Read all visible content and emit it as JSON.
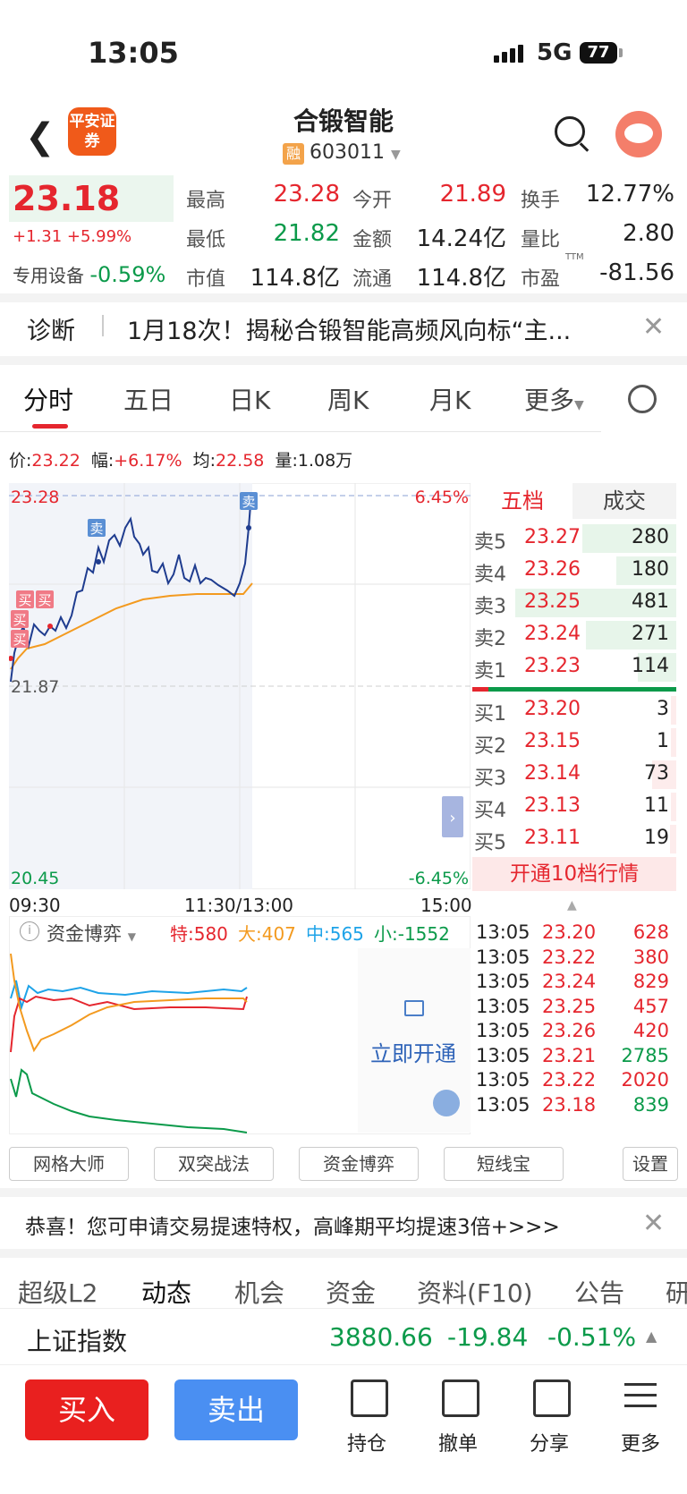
{
  "status": {
    "time": "13:05",
    "network": "5G",
    "battery": "77"
  },
  "header": {
    "broker_logo": "平安证券",
    "stock_name": "合锻智能",
    "rong": "融",
    "code": "603011"
  },
  "quote": {
    "price": "23.18",
    "change": "+1.31 +5.99%",
    "sector_label": "专用设备",
    "sector_change": "-0.59%",
    "high_label": "最高",
    "high": "23.28",
    "open_label": "今开",
    "open": "21.89",
    "turnover_label": "换手",
    "turnover": "12.77%",
    "low_label": "最低",
    "low": "21.82",
    "amount_label": "金额",
    "amount": "14.24亿",
    "ratio_label": "量比",
    "ratio": "2.80",
    "mktcap_label": "市值",
    "mktcap": "114.8亿",
    "float_label": "流通",
    "float": "114.8亿",
    "pe_label": "市盈",
    "pe_sup": "TTM",
    "pe": "-81.56"
  },
  "diagnosis": {
    "label": "诊断",
    "text": "1月18次！揭秘合锻智能高频风向标“主..."
  },
  "tabs": [
    "分时",
    "五日",
    "日K",
    "周K",
    "月K",
    "更多"
  ],
  "info_bar": {
    "price_label": "价:",
    "price": "23.22",
    "amp_label": "幅:",
    "amp": "+6.17%",
    "avg_label": "均:",
    "avg": "22.58",
    "vol_label": "量:",
    "vol": "1.08万"
  },
  "chart": {
    "y_top": "23.28",
    "y_mid": "21.87",
    "y_bottom": "20.45",
    "pct_top": "6.45%",
    "pct_bottom": "-6.45%",
    "x_start": "09:30",
    "x_mid": "11:30/13:00",
    "x_end": "15:00",
    "sell_tag": "卖",
    "buy_tag": "买"
  },
  "orderbook": {
    "tab_five": "五档",
    "tab_trades": "成交",
    "asks": [
      {
        "label": "卖5",
        "price": "23.27",
        "vol": "280"
      },
      {
        "label": "卖4",
        "price": "23.26",
        "vol": "180"
      },
      {
        "label": "卖3",
        "price": "23.25",
        "vol": "481"
      },
      {
        "label": "卖2",
        "price": "23.24",
        "vol": "271"
      },
      {
        "label": "卖1",
        "price": "23.23",
        "vol": "114"
      }
    ],
    "bids": [
      {
        "label": "买1",
        "price": "23.20",
        "vol": "3"
      },
      {
        "label": "买2",
        "price": "23.15",
        "vol": "1"
      },
      {
        "label": "买3",
        "price": "23.14",
        "vol": "73"
      },
      {
        "label": "买4",
        "price": "23.13",
        "vol": "11"
      },
      {
        "label": "买5",
        "price": "23.11",
        "vol": "19"
      }
    ],
    "open10": "开通10档行情"
  },
  "trades": [
    {
      "time": "13:05",
      "price": "23.20",
      "vol": "628",
      "color": "red"
    },
    {
      "time": "13:05",
      "price": "23.22",
      "vol": "380",
      "color": "red"
    },
    {
      "time": "13:05",
      "price": "23.24",
      "vol": "829",
      "color": "red"
    },
    {
      "time": "13:05",
      "price": "23.25",
      "vol": "457",
      "color": "red"
    },
    {
      "time": "13:05",
      "price": "23.26",
      "vol": "420",
      "color": "red"
    },
    {
      "time": "13:05",
      "price": "23.21",
      "vol": "2785",
      "color": "green"
    },
    {
      "time": "13:05",
      "price": "23.22",
      "vol": "2020",
      "color": "red"
    },
    {
      "time": "13:05",
      "price": "23.18",
      "vol": "839",
      "color": "green"
    }
  ],
  "capital": {
    "label": "资金博弈",
    "te": "特:580",
    "da": "大:407",
    "zhong": "中:565",
    "xiao": "小:-1552",
    "unlock": "立即开通"
  },
  "tools": [
    "网格大师",
    "双突战法",
    "资金博弈",
    "短线宝",
    "设置"
  ],
  "promo": "恭喜！您可申请交易提速特权，高峰期平均提速3倍+>>>",
  "bottom_tabs": [
    "超级L2",
    "动态",
    "机会",
    "资金",
    "资料(F10)",
    "公告",
    "研"
  ],
  "index": {
    "name": "上证指数",
    "value": "3880.66",
    "change": "-19.84",
    "pct": "-0.51%"
  },
  "actions": {
    "buy": "买入",
    "sell": "卖出",
    "hold": "持仓",
    "cancel": "撤单",
    "share": "分享",
    "more": "更多"
  },
  "colors": {
    "red": "#e5262e",
    "green": "#0b9a4a",
    "price_line": "#1f3c8f",
    "avg_line": "#f39a1f",
    "blue": "#4a8ff2"
  }
}
